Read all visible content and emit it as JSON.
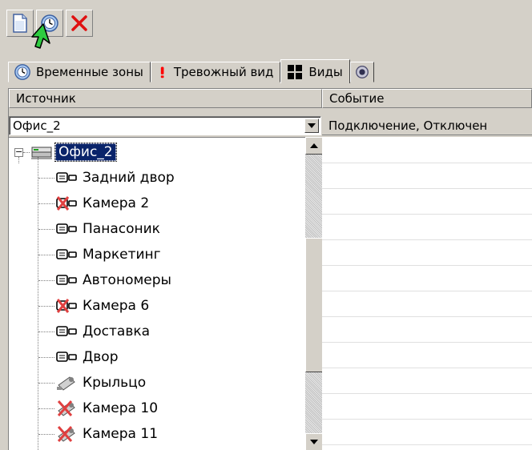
{
  "toolbar": {
    "buttons": [
      {
        "name": "new-document-button",
        "icon": "document-icon"
      },
      {
        "name": "schedule-button",
        "icon": "clock-globe-icon"
      },
      {
        "name": "delete-button",
        "icon": "red-x-icon"
      }
    ]
  },
  "tabs": [
    {
      "label": "Временные зоны",
      "icon": "clock-globe-icon"
    },
    {
      "label": "Тревожный вид",
      "icon": "exclamation-icon"
    },
    {
      "label": "Виды",
      "icon": "grid-icon",
      "active": true
    },
    {
      "label": "",
      "icon": "camera-lens-icon"
    }
  ],
  "left_panel": {
    "header": "Источник",
    "combo_value": "Офис_2"
  },
  "right_panel": {
    "header": "Событие",
    "first_row": "Подключение, Отключен"
  },
  "tree": {
    "root": "Офис_2",
    "items": [
      {
        "label": "Задний двор",
        "icon": "camera-icon",
        "disabled": false
      },
      {
        "label": "Камера 2",
        "icon": "camera-disabled-icon",
        "disabled": true
      },
      {
        "label": "Панасоник",
        "icon": "camera-icon",
        "disabled": false
      },
      {
        "label": "Маркетинг",
        "icon": "camera-icon",
        "disabled": false
      },
      {
        "label": "Автономеры",
        "icon": "camera-icon",
        "disabled": false
      },
      {
        "label": "Камера 6",
        "icon": "camera-disabled-icon",
        "disabled": true
      },
      {
        "label": "Доставка",
        "icon": "camera-icon",
        "disabled": false
      },
      {
        "label": "Двор",
        "icon": "camera-icon",
        "disabled": false
      },
      {
        "label": "Крыльцо",
        "icon": "dome-camera-icon",
        "disabled": false
      },
      {
        "label": "Камера 10",
        "icon": "dome-camera-disabled-icon",
        "disabled": true
      },
      {
        "label": "Камера 11",
        "icon": "dome-camera-disabled-icon",
        "disabled": true
      }
    ]
  },
  "colors": {
    "background": "#d4d0c8",
    "selection": "#0a246a",
    "delete_red": "#e01010",
    "alarm_red": "#ff0000",
    "cursor_green": "#2ecc40"
  }
}
